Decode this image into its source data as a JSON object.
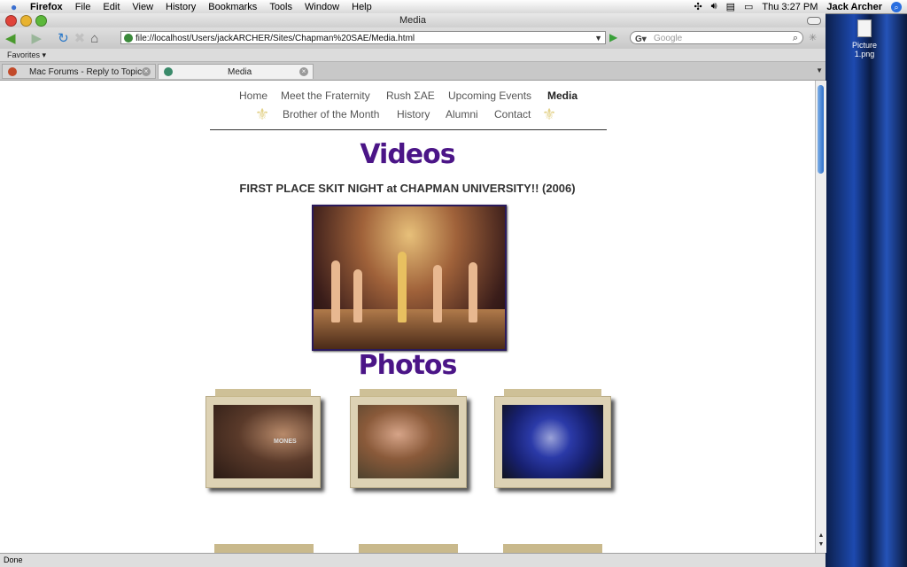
{
  "menubar": {
    "app": "Firefox",
    "items": [
      "File",
      "Edit",
      "View",
      "History",
      "Bookmarks",
      "Tools",
      "Window",
      "Help"
    ],
    "clock": "Thu 3:27 PM",
    "user": "Jack Archer"
  },
  "desktop": {
    "file_label": "Picture 1.png"
  },
  "window": {
    "title": "Media"
  },
  "toolbar": {
    "url": "file://localhost/Users/jackARCHER/Sites/Chapman%20SAE/Media.html",
    "search_placeholder": "Google"
  },
  "favorites": {
    "label": "Favorites ▾"
  },
  "tabs": [
    {
      "label": "Mac Forums - Reply to Topic"
    },
    {
      "label": "Media"
    }
  ],
  "site": {
    "nav_row1": [
      "Home",
      "Meet the Fraternity",
      "Rush ΣAE",
      "Upcoming Events",
      "Media"
    ],
    "nav_row2": [
      "Brother of the Month",
      "History",
      "Alumni",
      "Contact"
    ],
    "active": "Media",
    "videos_heading": "Videos",
    "video_title": "FIRST PLACE SKIT NIGHT at CHAPMAN UNIVERSITY!! (2006)",
    "photos_heading": "Photos",
    "photo1_shirt_text": "MONES"
  },
  "status": {
    "text": "Done"
  },
  "colors": {
    "heading": "#4b1587",
    "fleur": "#e3d28a",
    "frame": "#ddd2b4"
  }
}
